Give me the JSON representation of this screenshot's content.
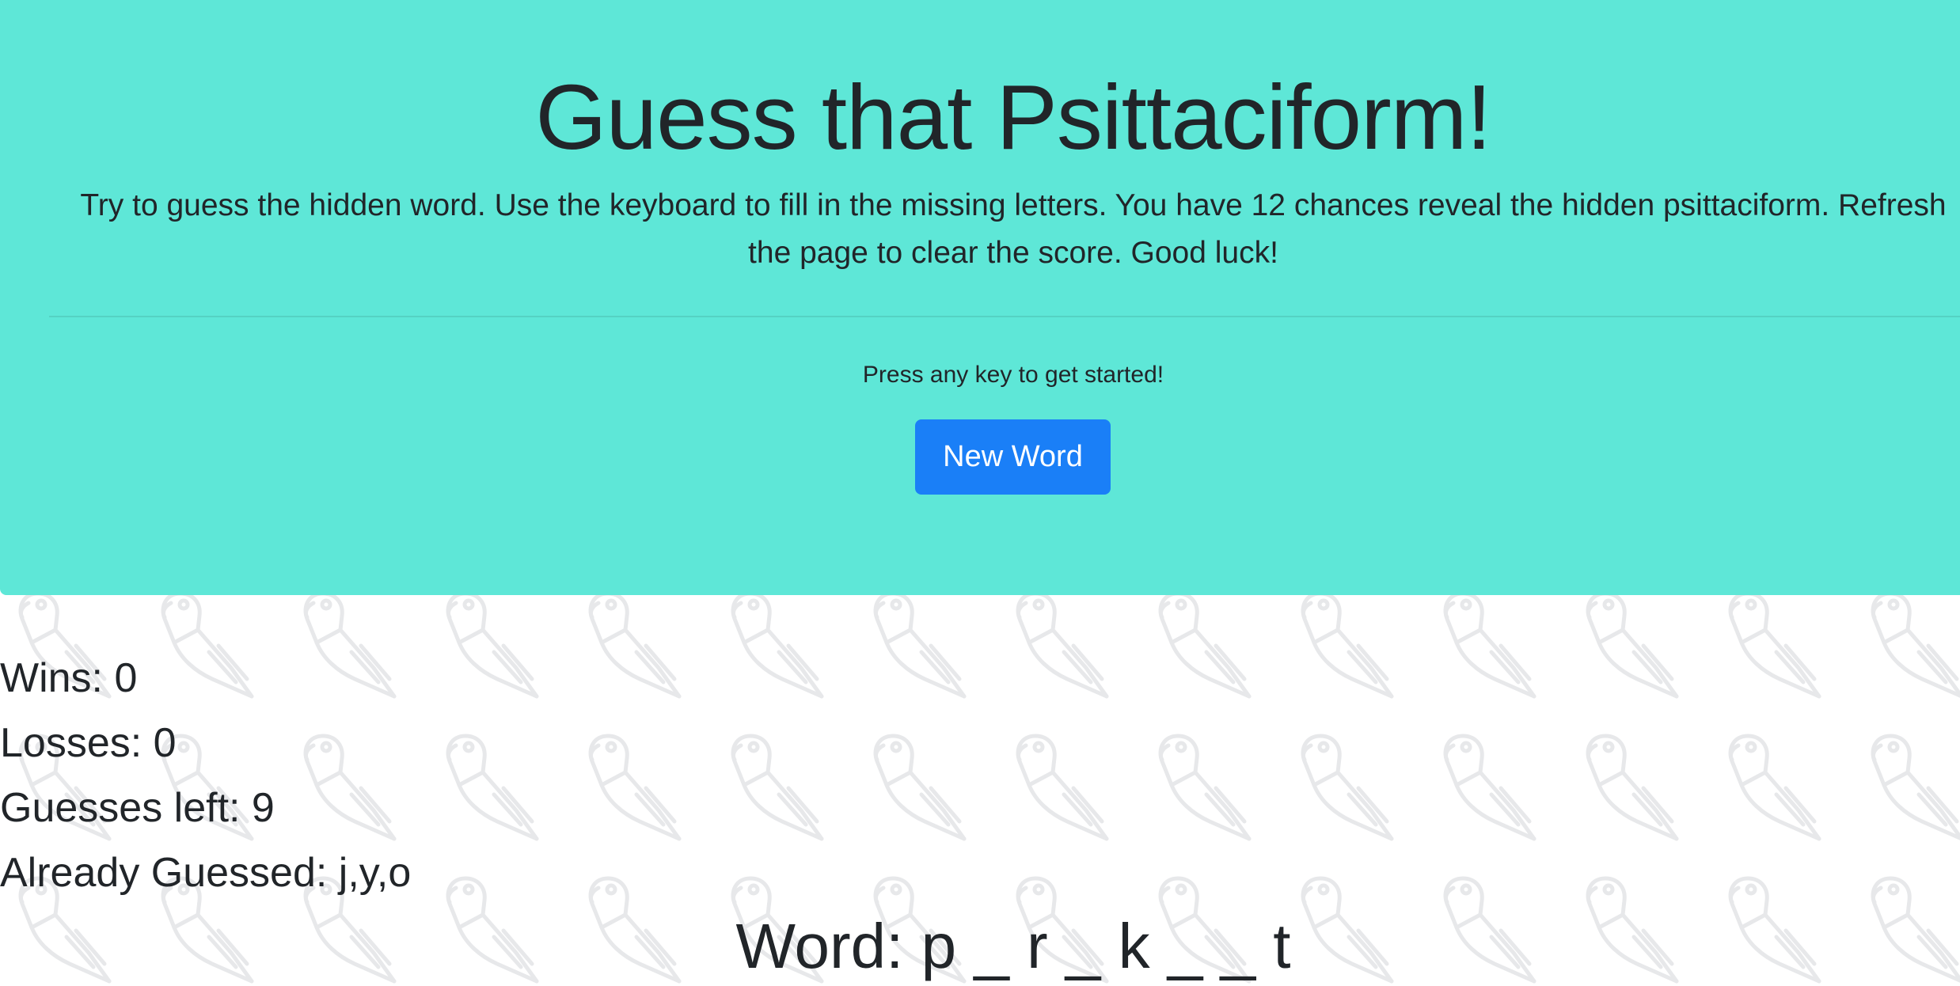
{
  "colors": {
    "jumbotron_bg": "#5ee7d7",
    "button_bg": "#1a7ff7",
    "text": "#212529",
    "pattern": "#e7e8ea"
  },
  "background": {
    "icon": "parrot-pattern-icon"
  },
  "header": {
    "title": "Guess that Psittaciform!",
    "instructions": "Try to guess the hidden word. Use the keyboard to fill in the missing letters. You have 12 chances reveal the hidden psittaciform. Refresh the page to clear the score. Good luck!",
    "start_message": "Press any key to get started!",
    "new_word_label": "New Word"
  },
  "stats": {
    "wins": "Wins: 0",
    "losses": "Losses: 0",
    "guesses_left": "Guesses left: 9",
    "already_guessed": "Already Guessed: j,y,o"
  },
  "word": {
    "display": "Word: p _ r _ k _ _ t"
  }
}
